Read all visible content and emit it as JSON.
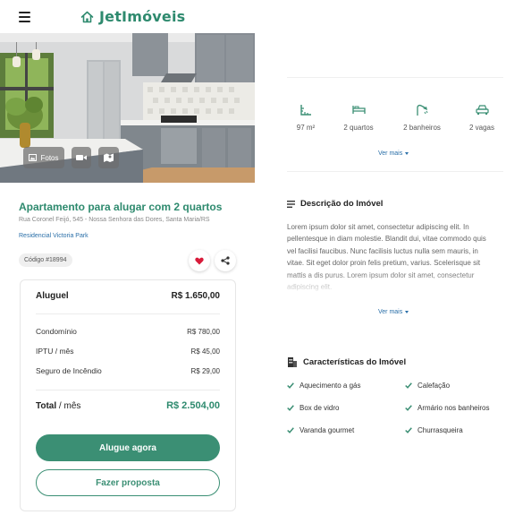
{
  "header": {
    "brand": "JetImóveis",
    "menu_icon": "hamburger-icon",
    "logo_icon": "house-icon"
  },
  "gallery": {
    "photos_label": "Fotos",
    "photos_icon": "image-icon",
    "video_icon": "video-camera-icon",
    "map_icon": "map-icon"
  },
  "listing": {
    "title": "Apartamento para alugar com 2 quartos",
    "address": "Rua Coronel Feijó, 545 - Nossa Senhora das Dores, Santa Maria/RS",
    "condo": "Residencial Victoria Park",
    "code": "Código #18994"
  },
  "pricing": {
    "rent_label": "Aluguel",
    "rent_value": "R$ 1.650,00",
    "items": [
      {
        "label": "Condomínio",
        "value": "R$ 780,00"
      },
      {
        "label": "IPTU / mês",
        "value": "R$ 45,00"
      },
      {
        "label": "Seguro de Incêndio",
        "value": "R$ 29,00"
      }
    ],
    "total_label_bold": "Total",
    "total_label_rest": " / mês",
    "total_value": "R$ 2.504,00",
    "primary_button": "Alugue agora",
    "secondary_button": "Fazer proposta"
  },
  "features": [
    {
      "icon": "area-icon",
      "label": "97 m²"
    },
    {
      "icon": "bed-icon",
      "label": "2 quartos"
    },
    {
      "icon": "shower-icon",
      "label": "2 banheiros"
    },
    {
      "icon": "car-icon",
      "label": "2 vagas"
    }
  ],
  "see_more": "Ver mais",
  "description": {
    "title": "Descrição do Imóvel",
    "text": "Lorem ipsum dolor sit amet, consectetur adipiscing elit. In pellentesque in diam molestie. Blandit dui, vitae commodo quis vel facilisi faucibus. Nunc facilisis luctus nulla sem mauris, in vitae. Sit eget dolor proin felis pretium, varius. Scelerisque sit mattis a dis purus. Lorem ipsum dolor sit amet, consectetur adipiscing elit."
  },
  "characteristics": {
    "title": "Características do Imóvel",
    "items": [
      "Aquecimento a gás",
      "Calefação",
      "Box de vidro",
      "Armário nos banheiros",
      "Varanda gourmet",
      "Churrasqueira"
    ]
  },
  "colors": {
    "brand": "#2e8a6e",
    "button": "#3b8f74",
    "link": "#2a6fa8",
    "favorite": "#d81b3a"
  }
}
